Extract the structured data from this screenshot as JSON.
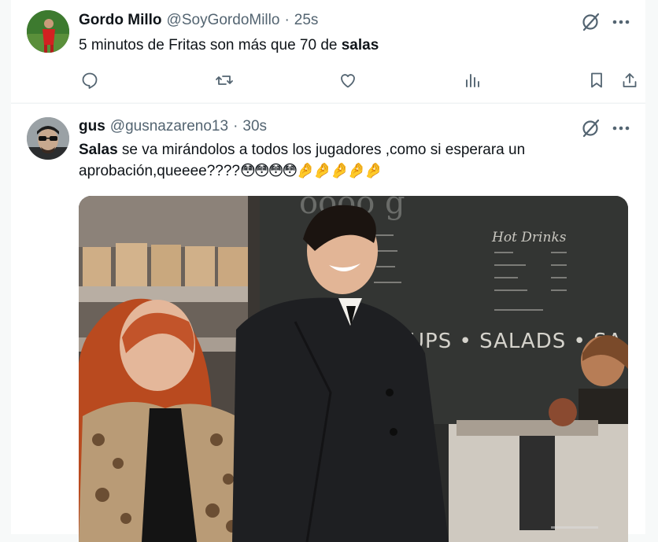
{
  "tweets": [
    {
      "author": {
        "name": "Gordo Millo",
        "handle": "@SoyGordoMillo",
        "separator": "·",
        "time": "25s"
      },
      "text": {
        "before": "5 minutos de Fritas son más que 70 de ",
        "highlight": "salas",
        "after": ""
      },
      "actions": [
        "reply-icon",
        "retweet-icon",
        "like-icon",
        "views-icon",
        "bookmark-icon",
        "share-icon"
      ]
    },
    {
      "author": {
        "name": "gus",
        "handle": "@gusnazareno13",
        "separator": "·",
        "time": "30s"
      },
      "text": {
        "highlight": "Salas",
        "after": " se va mirándolos a todos los jugadores ,como si esperara un aprobación,queeee????",
        "emojis": "😳😳😳😳🤌🤌🤌🤌🤌"
      },
      "media": {
        "type": "gif",
        "scene_text": "UPS • SALADS • SA",
        "board_heading": "Hot Drinks"
      }
    }
  ],
  "colors": {
    "text": "#0f1419",
    "secondary": "#536471",
    "background": "#f7f9f9",
    "card": "#ffffff"
  }
}
